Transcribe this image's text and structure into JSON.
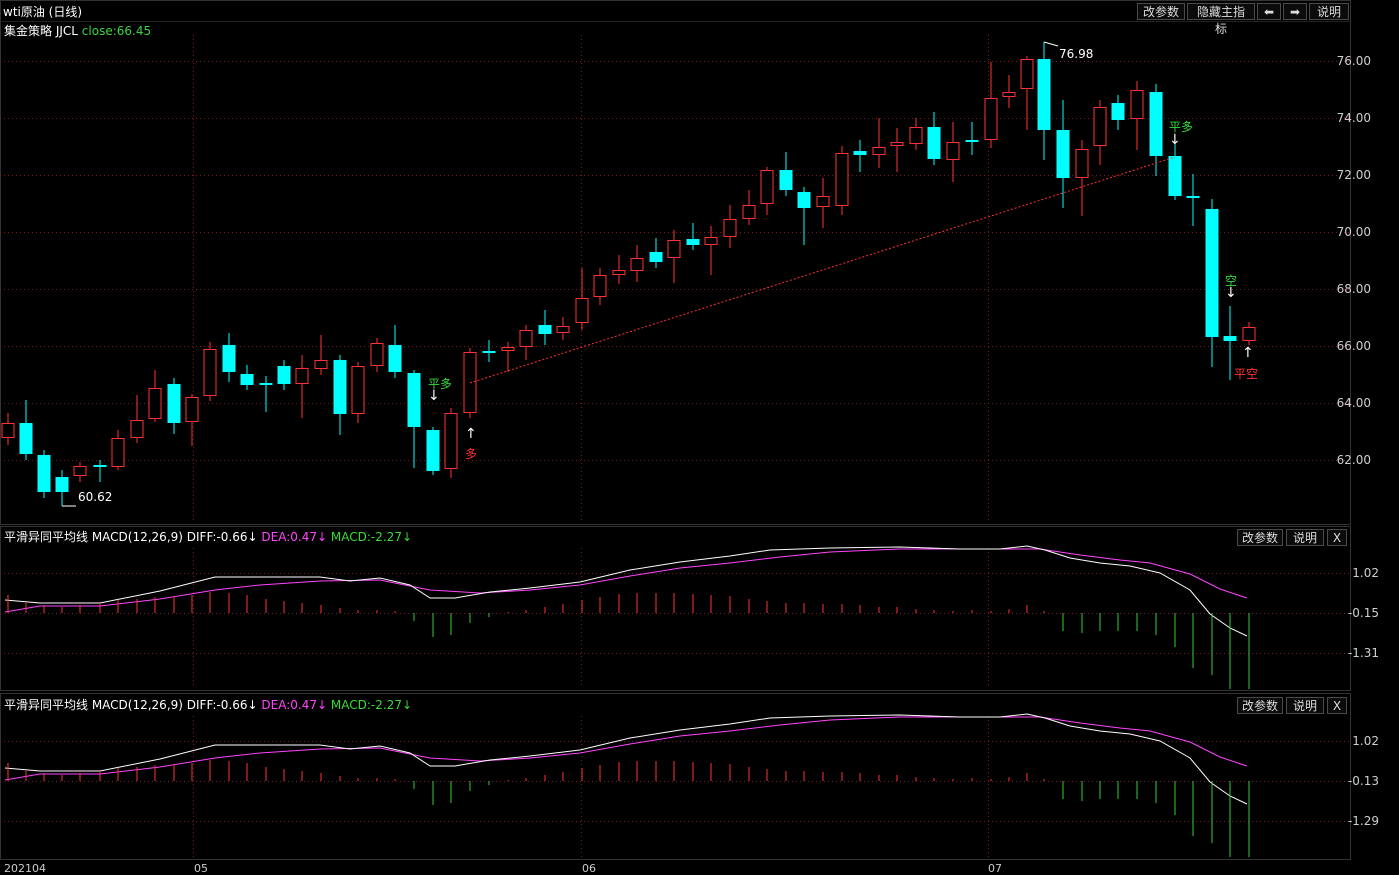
{
  "header": {
    "title": "wti原油 (日线)",
    "buttons": {
      "params": "改参数",
      "hide_indicator": "隐藏主指标",
      "prev": "⬅",
      "next": "➡",
      "help": "说明"
    }
  },
  "strategy": {
    "name": "集金策略 JJCL",
    "close_label": "close:66.45",
    "close_color": "#3cd43c"
  },
  "main_chart": {
    "y_labels": [
      "76.00",
      "74.00",
      "72.00",
      "70.00",
      "68.00",
      "66.00",
      "64.00",
      "62.00"
    ],
    "high_label": "76.98",
    "low_label": "60.62",
    "signals": {
      "flat_long_1": "平多",
      "long": "多",
      "flat_long_2": "平多",
      "short": "空",
      "flat_short": "平空"
    },
    "arrows": {
      "down": "↓",
      "up": "↑"
    }
  },
  "macd1": {
    "name": "平滑异同平均线 MACD(12,26,9)",
    "diff": "DIFF:-0.66↓",
    "dea": "DEA:0.47↓",
    "macd": "MACD:-2.27↓",
    "y_labels": [
      "1.02",
      "-0.15",
      "-1.31"
    ],
    "buttons": {
      "params": "改参数",
      "help": "说明",
      "close": "X"
    }
  },
  "macd2": {
    "name": "平滑异同平均线 MACD(12,26,9)",
    "diff": "DIFF:-0.66↓",
    "dea": "DEA:0.47↓",
    "macd": "MACD:-2.27↓",
    "y_labels": [
      "1.02",
      "-0.13",
      "-1.29"
    ],
    "buttons": {
      "params": "改参数",
      "help": "说明",
      "close": "X"
    }
  },
  "x_axis": {
    "labels": [
      "202104",
      "05",
      "06",
      "07"
    ]
  },
  "colors": {
    "up": "#ff3232",
    "down": "#00ffff",
    "dea": "#ff44ff",
    "diff": "#ffffff",
    "grid": "#7a1c1c",
    "neg_bar": "#33cc33"
  }
}
